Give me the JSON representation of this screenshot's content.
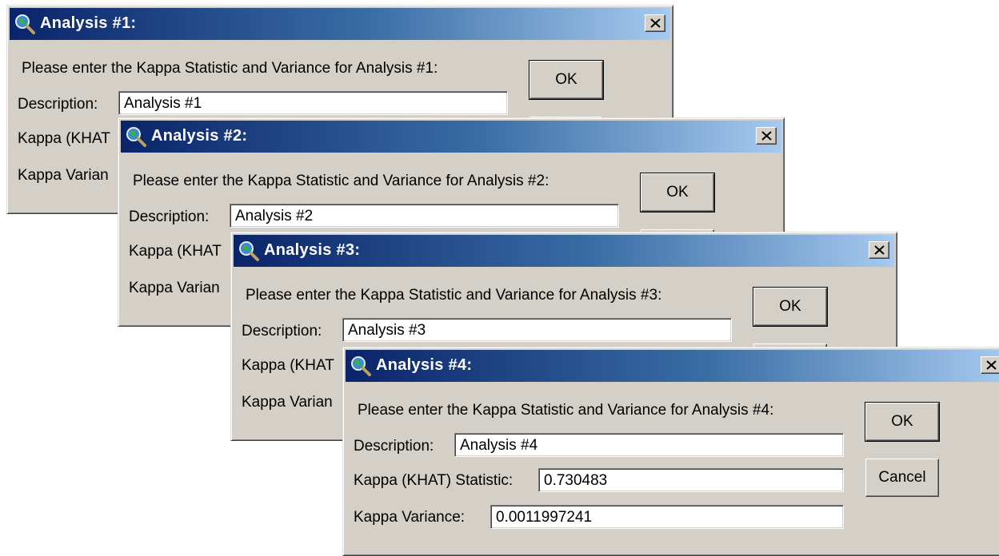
{
  "dialogs": [
    {
      "title": "Analysis #1:",
      "prompt": "Please enter the Kappa Statistic and Variance for Analysis #1:",
      "description_label": "Description:",
      "description_value": "Analysis #1",
      "kappa_label": "Kappa (KHAT",
      "variance_label": "Kappa Varian",
      "ok_label": "OK"
    },
    {
      "title": "Analysis #2:",
      "prompt": "Please enter the Kappa Statistic and Variance for Analysis #2:",
      "description_label": "Description:",
      "description_value": "Analysis #2",
      "kappa_label": "Kappa (KHAT",
      "variance_label": "Kappa Varian",
      "ok_label": "OK"
    },
    {
      "title": "Analysis #3:",
      "prompt": "Please enter the Kappa Statistic and Variance for Analysis #3:",
      "description_label": "Description:",
      "description_value": "Analysis #3",
      "kappa_label": "Kappa (KHAT",
      "variance_label": "Kappa Varian",
      "ok_label": "OK"
    },
    {
      "title": "Analysis #4:",
      "prompt": "Please enter the Kappa Statistic and Variance for Analysis #4:",
      "description_label": "Description:",
      "description_value": "Analysis #4",
      "kappa_label": "Kappa (KHAT) Statistic:",
      "kappa_value": "0.730483",
      "variance_label": "Kappa Variance:",
      "variance_value": "0.0011997241",
      "ok_label": "OK",
      "cancel_label": "Cancel"
    }
  ],
  "icons": {
    "app": "magnifier-globe-icon",
    "close": "close-icon"
  },
  "colors": {
    "titlebar_start": "#0a246a",
    "titlebar_end": "#a6caf0",
    "dialog_face": "#d4d0c8"
  }
}
